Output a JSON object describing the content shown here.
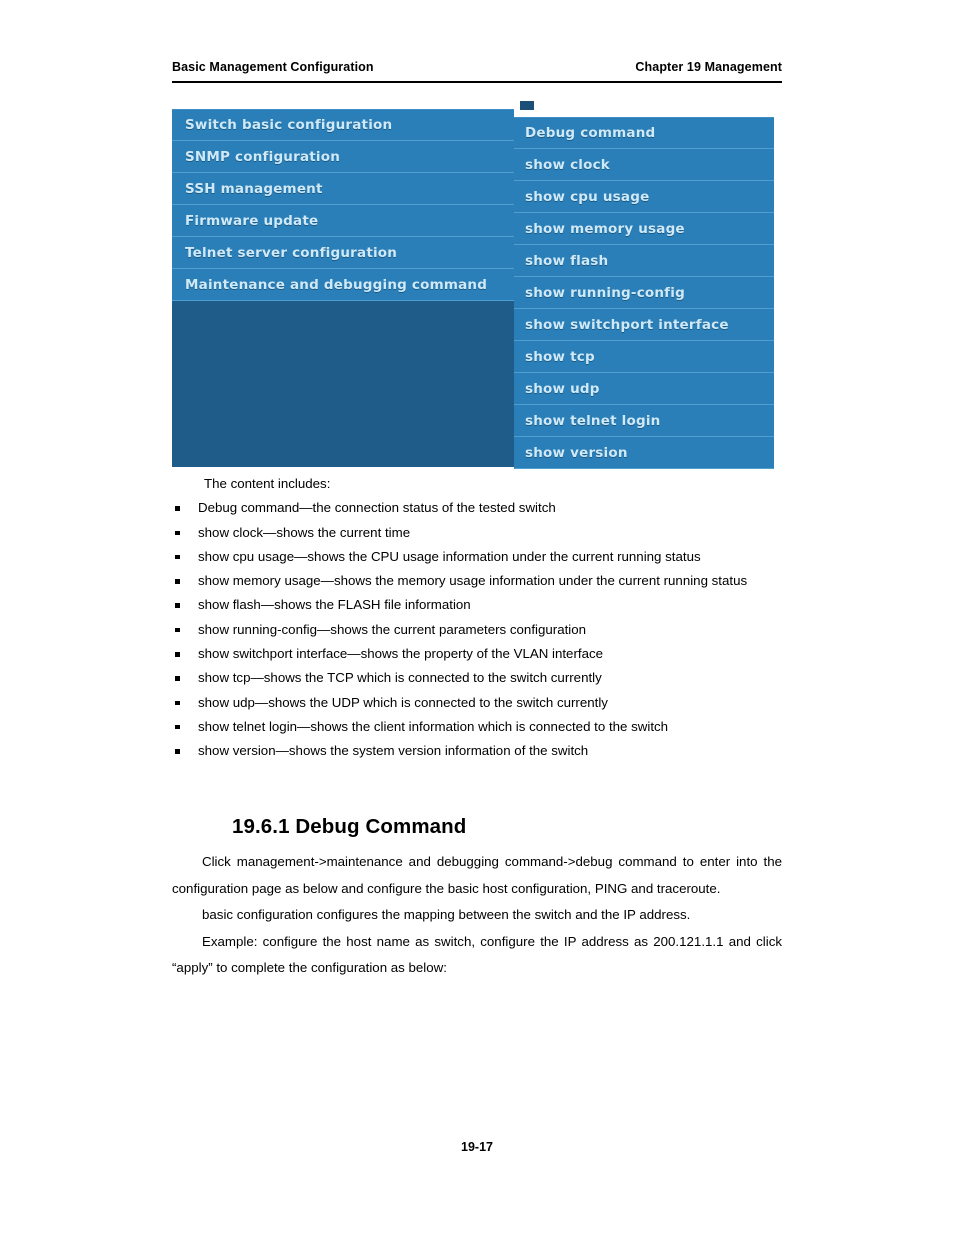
{
  "header": {
    "left_title": "Basic Management Configuration",
    "right_title": "Chapter 19 Management"
  },
  "figure": {
    "name": "web-management-menu-screenshot",
    "colors": {
      "panel_blue": "#2a7fb8",
      "panel_dark_blue": "#1f5c8a",
      "separator": "#4f9fd0",
      "menu_text": "#cfe9f7"
    },
    "left_menu": [
      {
        "label": "Switch basic configuration"
      },
      {
        "label": "SNMP configuration"
      },
      {
        "label": "SSH management"
      },
      {
        "label": "Firmware update"
      },
      {
        "label": "Telnet server configuration"
      },
      {
        "label": "Maintenance and debugging command"
      }
    ],
    "right_menu": [
      {
        "label": "Debug command"
      },
      {
        "label": "show clock"
      },
      {
        "label": "show cpu usage"
      },
      {
        "label": "show memory usage"
      },
      {
        "label": "show flash"
      },
      {
        "label": "show running-config"
      },
      {
        "label": "show switchport interface"
      },
      {
        "label": "show tcp"
      },
      {
        "label": "show udp"
      },
      {
        "label": "show telnet login"
      },
      {
        "label": "show version"
      }
    ]
  },
  "content": {
    "lead_in": "The content includes:",
    "bullets": [
      "Debug command—the connection status of the tested switch",
      "show clock—shows the current time",
      "show cpu usage—shows the CPU usage information under the current running status",
      "show memory usage—shows the memory usage information under the current running status",
      "show flash—shows the FLASH file information",
      "show running-config—shows the current parameters configuration",
      "show switchport interface—shows the property of the VLAN interface",
      "show tcp—shows the TCP which is connected to the switch currently",
      "show udp—shows the UDP which is connected to the switch currently",
      "show telnet login—shows the client information which is connected to the switch",
      "show version—shows the system version information of the switch"
    ]
  },
  "section": {
    "heading": "19.6.1 Debug Command",
    "paragraphs": [
      "Click management->maintenance and debugging command->debug command to enter into the configuration page as below and configure the basic host configuration, PING and traceroute.",
      "basic configuration configures the mapping between the switch and the IP address.",
      "Example: configure the host name as switch, configure the IP address as 200.121.1.1 and click “apply” to complete the configuration as below:"
    ]
  },
  "footer": {
    "page_number": "19-17"
  }
}
